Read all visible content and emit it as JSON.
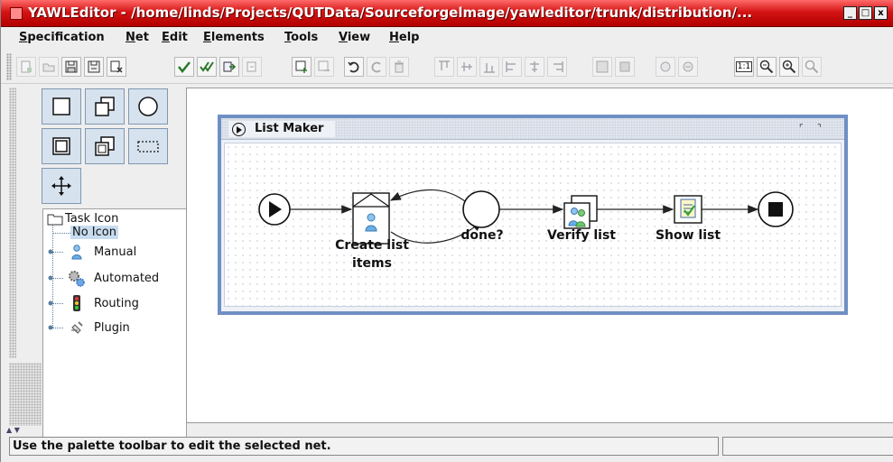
{
  "window": {
    "title": "YAWLEditor - /home/linds/Projects/QUTData/Sourceforgelmage/yawleditor/trunk/distribution/...",
    "controls": [
      "_",
      "□",
      "x"
    ]
  },
  "menubar": {
    "items": [
      {
        "label": "Specification",
        "u": "S",
        "rest": "pecification"
      },
      {
        "label": "Net",
        "u": "N",
        "rest": "et"
      },
      {
        "label": "Edit",
        "u": "E",
        "rest": "dit"
      },
      {
        "label": "Elements",
        "u": "E",
        "rest": "lements"
      },
      {
        "label": "Tools",
        "u": "T",
        "rest": "ools"
      },
      {
        "label": "View",
        "u": "V",
        "rest": "iew"
      },
      {
        "label": "Help",
        "u": "H",
        "rest": "elp"
      }
    ]
  },
  "toolbar": {
    "zoom_actual_label": "1:1"
  },
  "tree": {
    "root": "Task Icon",
    "no_icon": "No Icon",
    "items": [
      "Manual",
      "Automated",
      "Routing",
      "Plugin"
    ]
  },
  "net": {
    "title": "List Maker",
    "tasks": {
      "create": "Create list items",
      "create_line1": "Create list",
      "create_line2": "items",
      "done": "done?",
      "verify": "Verify list",
      "show": "Show list"
    }
  },
  "status": {
    "text": "Use the palette toolbar to edit the selected net.",
    "right": ""
  },
  "colors": {
    "title_bar": "#c00000",
    "net_frame": "#6f8fc4",
    "palette_button": "#d6e2ee",
    "tree_selection": "#c8dcf0"
  }
}
